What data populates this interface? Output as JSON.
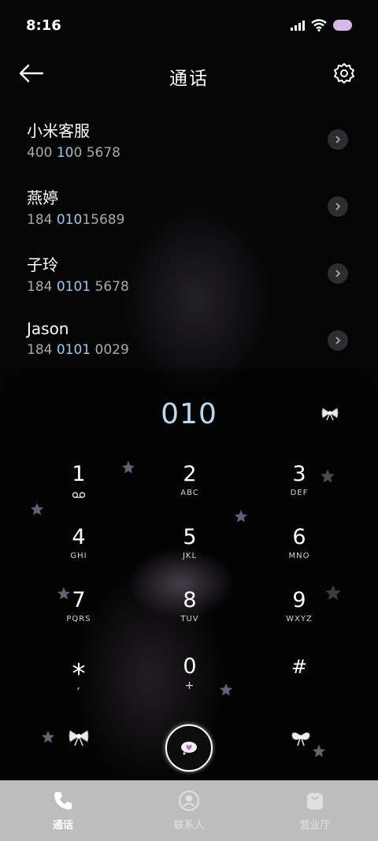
{
  "status_bar": {
    "time": "8:16",
    "battery": "100"
  },
  "header": {
    "title": "通话"
  },
  "contacts": [
    {
      "name": "小米客服",
      "number_pre": "400 ",
      "number_hl": "10",
      "number_post": "0 5678"
    },
    {
      "name": "燕婷",
      "number_pre": "184 ",
      "number_hl": "010",
      "number_post": "15689"
    },
    {
      "name": "子玲",
      "number_pre": "184 ",
      "number_hl": "0101",
      "number_post": " 5678"
    },
    {
      "name": "Jason",
      "number_pre": "184 ",
      "number_hl": "0101",
      "number_post": " 0029"
    }
  ],
  "dialer": {
    "input": "010",
    "keys": [
      {
        "digit": "1",
        "letters": ""
      },
      {
        "digit": "2",
        "letters": "ABC"
      },
      {
        "digit": "3",
        "letters": "DEF"
      },
      {
        "digit": "4",
        "letters": "GHI"
      },
      {
        "digit": "5",
        "letters": "JKL"
      },
      {
        "digit": "6",
        "letters": "MNO"
      },
      {
        "digit": "7",
        "letters": "PQRS"
      },
      {
        "digit": "8",
        "letters": "TUV"
      },
      {
        "digit": "9",
        "letters": "WXYZ"
      },
      {
        "digit": "*",
        "letters": ","
      },
      {
        "digit": "0",
        "letters": "+"
      },
      {
        "digit": "#",
        "letters": ""
      }
    ]
  },
  "bottom_nav": [
    {
      "label": "通话"
    },
    {
      "label": "联系人"
    },
    {
      "label": "营业厅"
    }
  ],
  "colors": {
    "highlight": "#9cc8ea",
    "star": "#6a5d75",
    "nav_bg": "#bdbdbd"
  }
}
